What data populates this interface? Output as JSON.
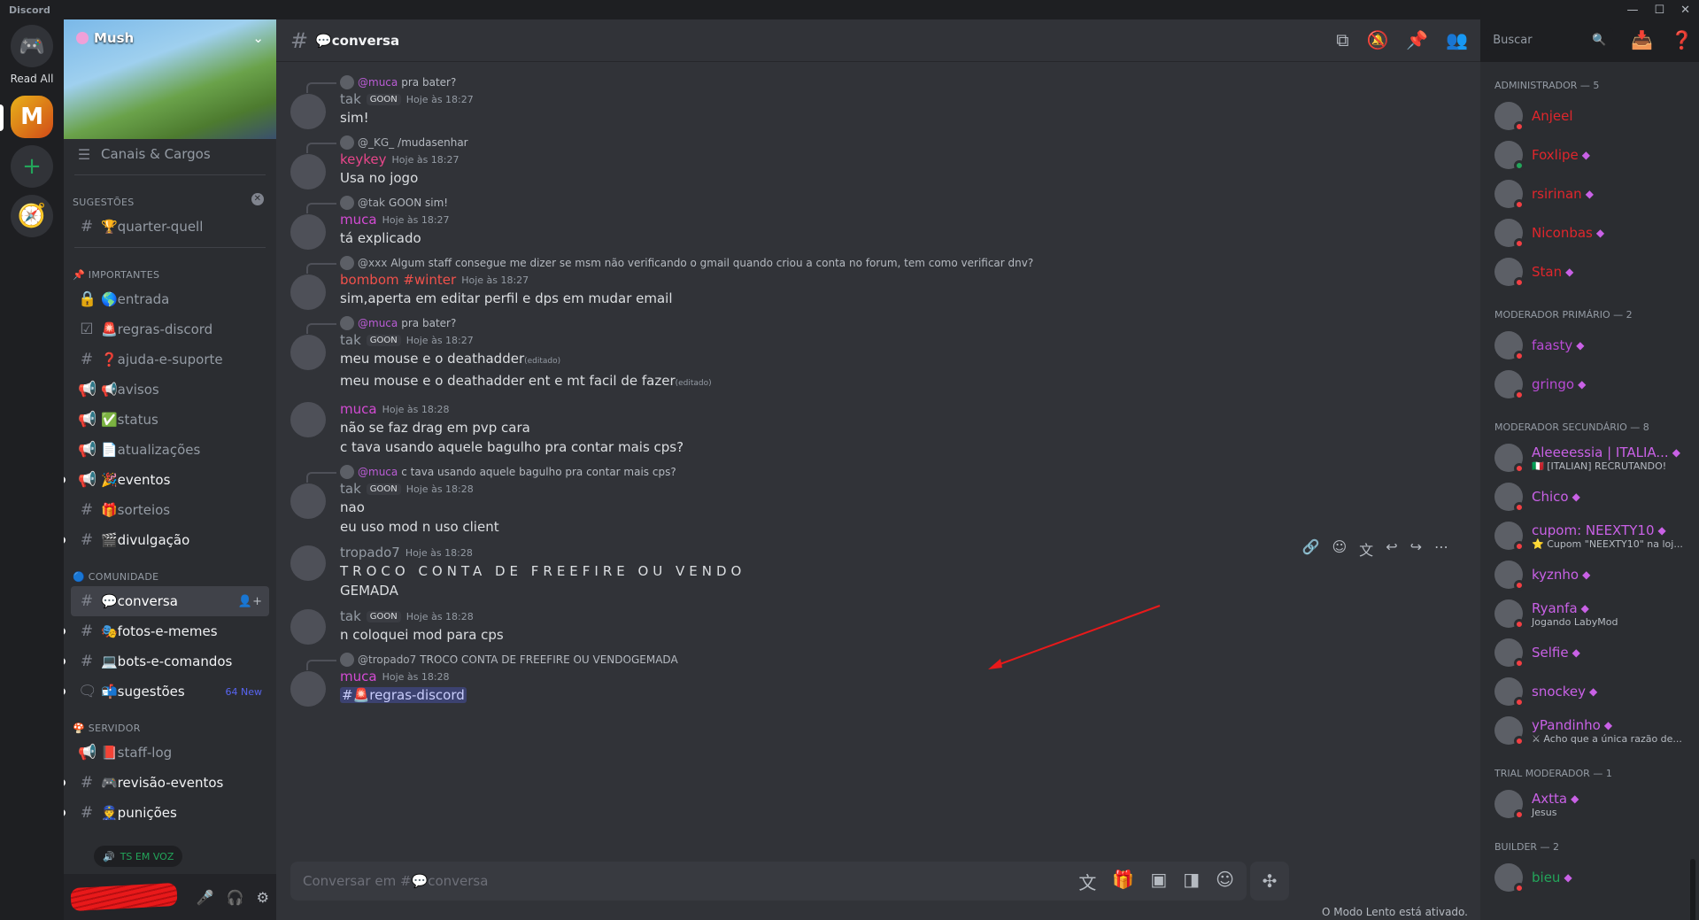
{
  "app": {
    "title": "Discord",
    "read_all": "Read All"
  },
  "server": {
    "name": "Mush",
    "channels_roles": "Canais & Cargos"
  },
  "sidebar": {
    "categories": [
      {
        "name": "SUGESTÕES",
        "channels": [
          {
            "name": "🏆quarter-quell",
            "icon": "#",
            "bold": false
          }
        ]
      },
      {
        "name": "📌 IMPORTANTES",
        "channels": [
          {
            "name": "🌎entrada",
            "icon": "🔒",
            "bold": false
          },
          {
            "name": "🚨regras-discord",
            "icon": "☑",
            "bold": false
          },
          {
            "name": "❓ajuda-e-suporte",
            "icon": "#",
            "bold": false
          },
          {
            "name": "📢avisos",
            "icon": "📢",
            "bold": false
          },
          {
            "name": "✅status",
            "icon": "📢",
            "bold": false
          },
          {
            "name": "📄atualizações",
            "icon": "📢",
            "bold": false
          },
          {
            "name": "🎉eventos",
            "icon": "📢",
            "bold": true
          },
          {
            "name": "🎁sorteios",
            "icon": "#",
            "bold": false
          },
          {
            "name": "🎬divulgação",
            "icon": "#",
            "bold": true
          }
        ]
      },
      {
        "name": "🔵 COMUNIDADE",
        "channels": [
          {
            "name": "💬conversa",
            "icon": "#",
            "bold": true,
            "active": true
          },
          {
            "name": "🎭fotos-e-memes",
            "icon": "#",
            "bold": true
          },
          {
            "name": "💻bots-e-comandos",
            "icon": "#",
            "bold": true
          },
          {
            "name": "📬sugestões",
            "icon": "🗨",
            "bold": true,
            "badge": "64 New"
          }
        ]
      },
      {
        "name": "🍄 SERVIDOR",
        "channels": [
          {
            "name": "📕staff-log",
            "icon": "📢",
            "bold": false
          },
          {
            "name": "🎮revisão-eventos",
            "icon": "#",
            "bold": true
          },
          {
            "name": "👮punições",
            "icon": "#",
            "bold": true
          }
        ]
      }
    ],
    "voice_label": "TS EM VOZ"
  },
  "chat": {
    "channel": "💬conversa",
    "search_placeholder": "Buscar",
    "composer_placeholder": "Conversar em #💬conversa",
    "slow_mode": "O Modo Lento está ativado.",
    "messages": [
      {
        "reply_to": "@muca",
        "reply_text": "pra bater?",
        "author": "tak",
        "tag": "GOON",
        "time": "Hoje às 18:27",
        "lines": [
          "sim!"
        ],
        "color": "#949ba4"
      },
      {
        "reply_to": "@_KG_",
        "reply_text": "/mudasenhar",
        "author": "keykey",
        "tag": "",
        "time": "Hoje às 18:27",
        "lines": [
          "Usa no jogo"
        ],
        "color": "#e8468a"
      },
      {
        "reply_to": "@tak",
        "reply_text": "GOON  sim!",
        "author": "muca",
        "tag": "",
        "time": "Hoje às 18:27",
        "lines": [
          "tá explicado"
        ],
        "color": "#d44bd4"
      },
      {
        "reply_to": "@xxx",
        "reply_text": "Algum staff consegue me dizer se msm não verificando o gmail quando criou a conta no forum, tem como verificar dnv?",
        "author": "bombom #winter",
        "tag": "",
        "time": "Hoje às 18:27",
        "lines": [
          "sim,aperta em editar perfil e dps em mudar email"
        ],
        "color": "#f0514b"
      },
      {
        "reply_to": "@muca",
        "reply_text": "pra bater?",
        "author": "tak",
        "tag": "GOON",
        "time": "Hoje às 18:27",
        "lines": [
          "meu mouse e o deathadder",
          "meu mouse e o deathadder ent e mt facil de fazer"
        ],
        "edited": "(editado)",
        "color": "#949ba4"
      },
      {
        "reply_to": "",
        "reply_text": "",
        "author": "muca",
        "tag": "",
        "time": "Hoje às 18:28",
        "lines": [
          "não se faz drag em pvp cara",
          "c tava usando aquele bagulho pra contar mais cps?"
        ],
        "color": "#d44bd4"
      },
      {
        "reply_to": "@muca",
        "reply_text": "c tava usando aquele bagulho pra contar mais cps?",
        "author": "tak",
        "tag": "GOON",
        "time": "Hoje às 18:28",
        "lines": [
          "nao",
          "eu uso mod n uso client"
        ],
        "color": "#949ba4"
      },
      {
        "reply_to": "",
        "reply_text": "",
        "author": "tropado7",
        "tag": "",
        "time": "Hoje às 18:28",
        "lines": [
          "TROCO CONTA DE FREEFIRE OU VENDO",
          "GEMADA"
        ],
        "color": "#949ba4"
      },
      {
        "reply_to": "",
        "reply_text": "",
        "author": "tak",
        "tag": "GOON",
        "time": "Hoje às 18:28",
        "lines": [
          "n coloquei mod para cps"
        ],
        "color": "#949ba4"
      },
      {
        "reply_to": "@tropado7",
        "reply_text": "TROCO CONTA DE FREEFIRE OU VENDOGEMADA",
        "author": "muca",
        "tag": "",
        "time": "Hoje às 18:28",
        "lines": [
          "#🚨regras-discord"
        ],
        "color": "#d44bd4"
      }
    ]
  },
  "members": {
    "groups": [
      {
        "title": "ADMINISTRADOR — 5",
        "members": [
          {
            "name": "Anjeel",
            "color": "#e0262c",
            "sub": ""
          },
          {
            "name": "Foxlipe",
            "color": "#e0262c",
            "sub": ""
          },
          {
            "name": "rsirinan",
            "color": "#e0262c",
            "sub": ""
          },
          {
            "name": "Niconbas",
            "color": "#e0262c",
            "sub": ""
          },
          {
            "name": "Stan",
            "color": "#e0262c",
            "sub": ""
          }
        ]
      },
      {
        "title": "MODERADOR PRIMÁRIO — 2",
        "members": [
          {
            "name": "faasty",
            "color": "#b84bd4",
            "sub": ""
          },
          {
            "name": "gringo",
            "color": "#b84bd4",
            "sub": ""
          }
        ]
      },
      {
        "title": "MODERADOR SECUNDÁRIO — 8",
        "members": [
          {
            "name": "Aleeeessia | ITALIA...",
            "color": "#c961e6",
            "sub": "🇮🇹 [ITALIAN] RECRUTANDO!"
          },
          {
            "name": "Chico",
            "color": "#c961e6",
            "sub": ""
          },
          {
            "name": "cupom: NEEXTY10",
            "color": "#c961e6",
            "sub": "⭐ Cupom \"NEEXTY10\" na loj..."
          },
          {
            "name": "kyznho",
            "color": "#c961e6",
            "sub": ""
          },
          {
            "name": "Ryanfa",
            "color": "#c961e6",
            "sub": "Jogando LabyMod"
          },
          {
            "name": "Selfie",
            "color": "#c961e6",
            "sub": ""
          },
          {
            "name": "snockey",
            "color": "#c961e6",
            "sub": ""
          },
          {
            "name": "yPandinho",
            "color": "#c961e6",
            "sub": "⚔ Acho que a única razão de..."
          }
        ]
      },
      {
        "title": "TRIAL MODERADOR — 1",
        "members": [
          {
            "name": "Axtta",
            "color": "#c961e6",
            "sub": "Jesus"
          }
        ]
      },
      {
        "title": "BUILDER — 2",
        "members": [
          {
            "name": "bieu",
            "color": "#23a55a",
            "sub": ""
          }
        ]
      }
    ]
  },
  "colors": {
    "accent": "#5865f2",
    "admin": "#e0262c",
    "mod": "#c961e6",
    "arrow": "#e8191a"
  }
}
